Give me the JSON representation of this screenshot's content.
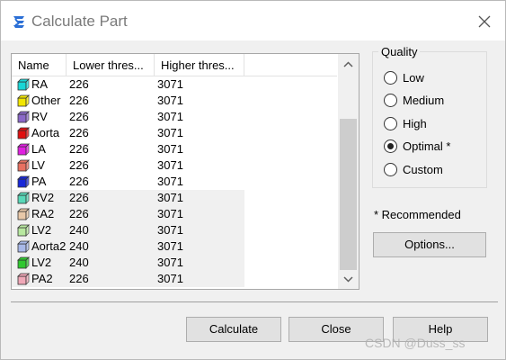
{
  "window": {
    "title": "Calculate Part"
  },
  "icons": {
    "app": "app-logo-icon",
    "close": "close-icon"
  },
  "table": {
    "columns": [
      "Name",
      "Lower thres...",
      "Higher thres..."
    ],
    "rows": [
      {
        "name": "RA",
        "lower": "226",
        "higher": "3071",
        "color": "#19d6d6",
        "shaded": false
      },
      {
        "name": "Other",
        "lower": "226",
        "higher": "3071",
        "color": "#f2e600",
        "shaded": false
      },
      {
        "name": "RV",
        "lower": "226",
        "higher": "3071",
        "color": "#8a68c8",
        "shaded": false
      },
      {
        "name": "Aorta",
        "lower": "226",
        "higher": "3071",
        "color": "#e01010",
        "shaded": false
      },
      {
        "name": "LA",
        "lower": "226",
        "higher": "3071",
        "color": "#e020e0",
        "shaded": false
      },
      {
        "name": "LV",
        "lower": "226",
        "higher": "3071",
        "color": "#e87060",
        "shaded": false
      },
      {
        "name": "PA",
        "lower": "226",
        "higher": "3071",
        "color": "#1828d8",
        "shaded": false
      },
      {
        "name": "RV2",
        "lower": "226",
        "higher": "3071",
        "color": "#58d8b8",
        "shaded": true
      },
      {
        "name": "RA2",
        "lower": "226",
        "higher": "3071",
        "color": "#e8c8a8",
        "shaded": true
      },
      {
        "name": "LV2",
        "lower": "240",
        "higher": "3071",
        "color": "#b8e8a0",
        "shaded": true
      },
      {
        "name": "Aorta2",
        "lower": "240",
        "higher": "3071",
        "color": "#a8b8e8",
        "shaded": true
      },
      {
        "name": "LV2",
        "lower": "240",
        "higher": "3071",
        "color": "#30c830",
        "shaded": true
      },
      {
        "name": "PA2",
        "lower": "226",
        "higher": "3071",
        "color": "#f0a8b8",
        "shaded": true
      }
    ]
  },
  "quality": {
    "legend": "Quality",
    "options": [
      "Low",
      "Medium",
      "High",
      "Optimal *",
      "Custom"
    ],
    "selected": "Optimal *"
  },
  "recommended_note": "* Recommended",
  "buttons": {
    "options": "Options...",
    "calculate": "Calculate",
    "close": "Close",
    "help": "Help"
  },
  "watermark": "CSDN @Duss_ss"
}
